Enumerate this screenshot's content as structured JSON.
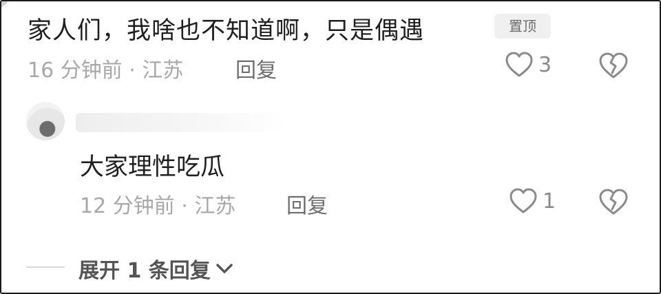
{
  "comment": {
    "text": "家人们，我啥也不知道啊，只是偶遇",
    "pin_badge": "置顶",
    "time": "16 分钟前",
    "separator": "·",
    "location": "江苏",
    "reply_label": "回复",
    "likes": "3"
  },
  "reply": {
    "text": "大家理性吃瓜",
    "time": "12 分钟前",
    "separator": "·",
    "location": "江苏",
    "reply_label": "回复",
    "likes": "1"
  },
  "expand": {
    "label": "展开 1 条回复"
  },
  "colors": {
    "text": "#1f1f1f",
    "meta": "#a8a8a8",
    "icon": "#8a8a8a",
    "badge_bg": "#f0f0f0"
  },
  "icons": {
    "like": "heart-outline-icon",
    "dislike": "broken-heart-icon",
    "expand": "chevron-down-icon"
  }
}
